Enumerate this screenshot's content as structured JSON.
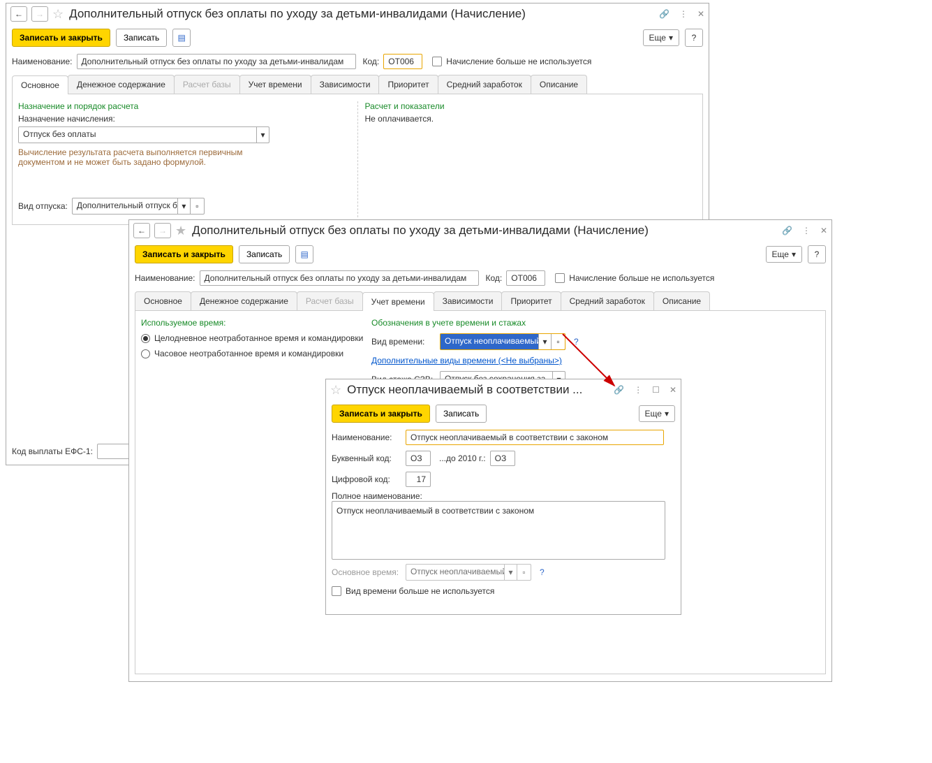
{
  "win1": {
    "title": "Дополнительный отпуск без оплаты по уходу за детьми-инвалидами (Начисление)",
    "save_close": "Записать и закрыть",
    "save": "Записать",
    "more": "Еще",
    "help": "?",
    "name_label": "Наименование:",
    "name_value": "Дополнительный отпуск без оплаты по уходу за детьми-инвалидам",
    "code_label": "Код:",
    "code_value": "ОТ006",
    "not_used_label": "Начисление больше не используется",
    "tabs": [
      {
        "label": "Основное"
      },
      {
        "label": "Денежное содержание"
      },
      {
        "label": "Расчет базы"
      },
      {
        "label": "Учет времени"
      },
      {
        "label": "Зависимости"
      },
      {
        "label": "Приоритет"
      },
      {
        "label": "Средний заработок"
      },
      {
        "label": "Описание"
      }
    ],
    "sec1_title": "Назначение и порядок расчета",
    "naz_label": "Назначение начисления:",
    "naz_value": "Отпуск без оплаты",
    "naz_note1": "Вычисление результата расчета выполняется первичным",
    "naz_note2": "документом и не может быть задано формулой.",
    "sec2_title": "Расчет и показатели",
    "sec2_text": "Не оплачивается.",
    "vid_label": "Вид отпуска:",
    "vid_value": "Дополнительный отпуск б",
    "efs_label": "Код выплаты ЕФС-1:"
  },
  "win2": {
    "title": "Дополнительный отпуск без оплаты по уходу за детьми-инвалидами (Начисление)",
    "save_close": "Записать и закрыть",
    "save": "Записать",
    "more": "Еще",
    "help": "?",
    "name_label": "Наименование:",
    "name_value": "Дополнительный отпуск без оплаты по уходу за детьми-инвалидам",
    "code_label": "Код:",
    "code_value": "ОТ006",
    "not_used_label": "Начисление больше не используется",
    "tabs": [
      {
        "label": "Основное"
      },
      {
        "label": "Денежное содержание"
      },
      {
        "label": "Расчет базы"
      },
      {
        "label": "Учет времени"
      },
      {
        "label": "Зависимости"
      },
      {
        "label": "Приоритет"
      },
      {
        "label": "Средний заработок"
      },
      {
        "label": "Описание"
      }
    ],
    "used_time_title": "Используемое время:",
    "radio1": "Целодневное неотработанное время и командировки",
    "radio2": "Часовое неотработанное время и командировки",
    "oboz_title": "Обозначения в учете времени и стажах",
    "vid_vrem_label": "Вид времени:",
    "vid_vrem_value": "Отпуск неоплачиваемый",
    "dop_vidy_link": "Дополнительные виды времени (<Не выбраны>)",
    "stazh_label": "Вид стажа СЗВ:",
    "stazh_value": "Отпуск без сохранения за"
  },
  "win3": {
    "title": "Отпуск неоплачиваемый в соответствии ...",
    "save_close": "Записать и закрыть",
    "save": "Записать",
    "more": "Еще",
    "name_label": "Наименование:",
    "name_value": "Отпуск неоплачиваемый в соответствии с законом",
    "letter_label": "Буквенный код:",
    "letter_value": "ОЗ",
    "until_label": "...до 2010 г.:",
    "until_value": "ОЗ",
    "digit_label": "Цифровой код:",
    "digit_value": "17",
    "full_label": "Полное наименование:",
    "full_value": "Отпуск неоплачиваемый в соответствии с законом",
    "base_label": "Основное время:",
    "base_value": "Отпуск неоплачиваемый",
    "not_used_label": "Вид времени больше не используется"
  }
}
